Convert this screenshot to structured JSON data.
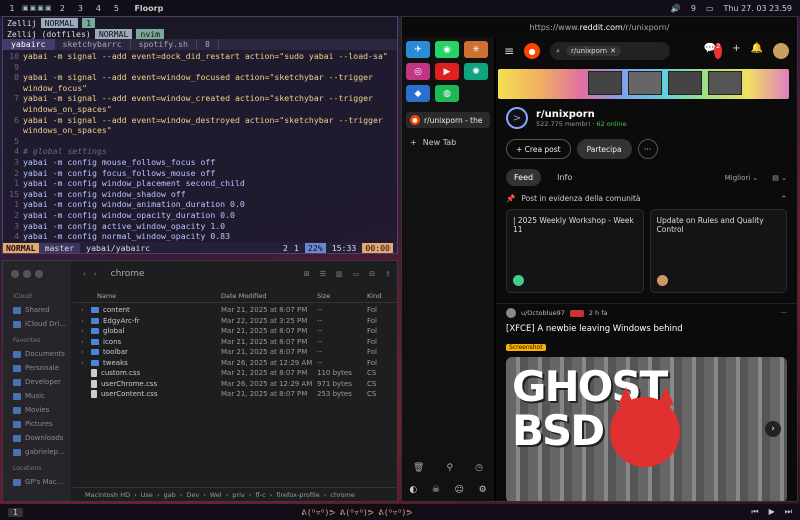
{
  "topbar": {
    "workspaces": [
      "1",
      "2",
      "3",
      "4",
      "5"
    ],
    "app_name": "Floorp",
    "volume_icon": "🔊",
    "notif_count": "9",
    "datetime": "Thu 27. 03  23.59"
  },
  "terminal": {
    "zellij_line1": "Zellij",
    "mode1": "NORMAL",
    "mode1_num": "1",
    "zellij_line2": "Zellij (dotfiles)",
    "mode2": "NORMAL",
    "mode2_app": "nvim",
    "tabs": [
      "yabairc",
      "sketchybarrc",
      "spotify.sh"
    ],
    "tab_count": "8",
    "lines": [
      {
        "n": "10",
        "t": "yabai -m signal --add event=dock_did_restart action=\"sudo yabai --load-sa\"",
        "k": "s"
      },
      {
        "n": "9",
        "t": "",
        "k": ""
      },
      {
        "n": "8",
        "t": "yabai -m signal --add event=window_focused action=\"sketchybar --trigger",
        "k": "s"
      },
      {
        "n": "",
        "t": "window_focus\"",
        "k": "s"
      },
      {
        "n": "7",
        "t": "yabai -m signal --add event=window_created action=\"sketchybar --trigger",
        "k": "s"
      },
      {
        "n": "",
        "t": "windows_on_spaces\"",
        "k": "s"
      },
      {
        "n": "6",
        "t": "yabai -m signal --add event=window_destroyed action=\"sketchybar --trigger",
        "k": "s"
      },
      {
        "n": "",
        "t": "windows_on_spaces\"",
        "k": "s"
      },
      {
        "n": "5",
        "t": "",
        "k": ""
      },
      {
        "n": "4",
        "t": "# global settings",
        "k": "c"
      },
      {
        "n": "3",
        "t": "yabai -m config mouse_follows_focus off",
        "k": ""
      },
      {
        "n": "2",
        "t": "yabai -m config focus_follows_mouse off",
        "k": ""
      },
      {
        "n": "1",
        "t": "yabai -m config window_placement second_child",
        "k": ""
      },
      {
        "n": "15",
        "t": "yabai -m config window_shadow off",
        "k": ""
      },
      {
        "n": "1",
        "t": "yabai -m config window_animation_duration 0.0",
        "k": ""
      },
      {
        "n": "2",
        "t": "yabai -m config window_opacity_duration 0.0",
        "k": ""
      },
      {
        "n": "3",
        "t": "yabai -m config active_window_opacity 1.0",
        "k": ""
      },
      {
        "n": "4",
        "t": "yabai -m config normal_window_opacity 0.83",
        "k": ""
      }
    ],
    "status": {
      "mode": "NORMAL",
      "branch": "master",
      "file": "yabai/yabairc",
      "errors": "2",
      "warnings": "1",
      "percent": "22%",
      "position": "15:33",
      "time": "00:00"
    }
  },
  "finder": {
    "title": "chrome",
    "sidebar": {
      "icloud_header": "iCloud",
      "icloud": [
        "Shared",
        "iCloud Dri..."
      ],
      "fav_header": "Favorites",
      "favorites": [
        "Documents",
        "Personale",
        "Developer",
        "Music",
        "Movies",
        "Pictures",
        "Downloads",
        "gabrielep..."
      ],
      "loc_header": "Locations",
      "locations": [
        "GP's Mac..."
      ]
    },
    "columns": [
      "Name",
      "Date Modified",
      "Size",
      "Kind"
    ],
    "rows": [
      {
        "name": "content",
        "date": "Mar 21, 2025 at 8:07 PM",
        "size": "--",
        "kind": "Fol",
        "type": "folder"
      },
      {
        "name": "EdgyArc-fr",
        "date": "Mar 22, 2025 at 3:25 PM",
        "size": "--",
        "kind": "Fol",
        "type": "folder"
      },
      {
        "name": "global",
        "date": "Mar 21, 2025 at 8:07 PM",
        "size": "--",
        "kind": "Fol",
        "type": "folder"
      },
      {
        "name": "icons",
        "date": "Mar 21, 2025 at 8:07 PM",
        "size": "--",
        "kind": "Fol",
        "type": "folder"
      },
      {
        "name": "toolbar",
        "date": "Mar 21, 2025 at 8:07 PM",
        "size": "--",
        "kind": "Fol",
        "type": "folder"
      },
      {
        "name": "tweaks",
        "date": "Mar 26, 2025 at 12:29 AM",
        "size": "--",
        "kind": "Fol",
        "type": "folder"
      },
      {
        "name": "custom.css",
        "date": "Mar 21, 2025 at 8:07 PM",
        "size": "110 bytes",
        "kind": "CS",
        "type": "file"
      },
      {
        "name": "userChrome.css",
        "date": "Mar 26, 2025 at 12:29 AM",
        "size": "971 bytes",
        "kind": "CS",
        "type": "file"
      },
      {
        "name": "userContent.css",
        "date": "Mar 21, 2025 at 8:07 PM",
        "size": "253 bytes",
        "kind": "CS",
        "type": "file"
      }
    ],
    "path": [
      "Macintosh HD",
      "Use",
      "gab",
      "Dev",
      "Wel",
      "priv",
      "ff-c",
      "firefox-profile",
      "chrome"
    ]
  },
  "browser": {
    "url_prefix": "https://www.",
    "url_domain": "reddit.com",
    "url_path": "/r/unixporn/",
    "tab_title": "r/unixporn - the",
    "new_tab": "New Tab",
    "search_chip": "r/unixporn",
    "sub_name": "r/unixporn",
    "members": "522.775 membri",
    "online": "62 online",
    "notif_badge": "2",
    "create_post": "Crea post",
    "join": "Partecipa",
    "feed": "Feed",
    "info": "Info",
    "sort": "Migliori",
    "pinned_label": "Post in evidenza della comunità",
    "cards": [
      "| 2025 Weekly Workshop - Week 11",
      "Update on Rules and Quality Control"
    ],
    "post_user": "u/Octoblue97",
    "post_time": "2 h fa",
    "post_title": "[XFCE] A newbie leaving Windows behind",
    "flair": "Screenshot",
    "img_text1": "GHOST",
    "img_text2": "BSD"
  },
  "bottombar": {
    "workspace": "1",
    "emoticons": "ᕕ(⁰▿⁰)ᕗ  ᕕ(⁰▿⁰)ᕗ  ᕕ(⁰▿⁰)ᕗ"
  },
  "colors": {
    "accent": "#e7a66e",
    "reddit": "#ff4500",
    "folder": "#4a86d6"
  }
}
